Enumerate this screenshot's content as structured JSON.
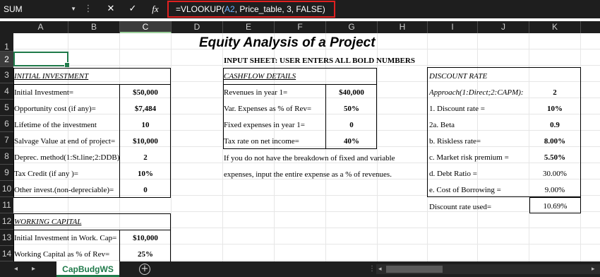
{
  "namebox": {
    "value": "SUM"
  },
  "formula_bar": {
    "cancel": "✕",
    "enter": "✓",
    "fx": "fx",
    "formula_prefix": "=VLOOKUP(",
    "formula_ref": "A2",
    "formula_suffix": ", Price_table, 3, FALSE)"
  },
  "columns": [
    "A",
    "B",
    "C",
    "D",
    "E",
    "F",
    "G",
    "H",
    "I",
    "J",
    "K"
  ],
  "rows": [
    "1",
    "2",
    "3",
    "4",
    "5",
    "6",
    "7",
    "8",
    "9",
    "10",
    "11",
    "12",
    "13",
    "14"
  ],
  "title": "Equity Analysis of a Project",
  "input_note": "INPUT SHEET: USER ENTERS ALL BOLD NUMBERS",
  "initial_investment": {
    "heading": "INITIAL INVESTMENT",
    "items": [
      {
        "label": "Initial Investment=",
        "value": "$50,000"
      },
      {
        "label": "Opportunity cost (if any)=",
        "value": "$7,484"
      },
      {
        "label": "Lifetime of the investment",
        "value": "10"
      },
      {
        "label": "Salvage Value at end of project=",
        "value": "$10,000"
      },
      {
        "label": "Deprec. method(1:St.line;2:DDB)",
        "value": "2"
      },
      {
        "label": "Tax Credit (if any )=",
        "value": "10%"
      },
      {
        "label": "Other invest.(non-depreciable)=",
        "value": "0"
      }
    ]
  },
  "cashflow": {
    "heading": "CASHFLOW DETAILS",
    "items": [
      {
        "label": "Revenues in  year 1=",
        "value": "$40,000"
      },
      {
        "label": "Var. Expenses as % of Rev=",
        "value": "50%"
      },
      {
        "label": "Fixed expenses in year 1=",
        "value": "0"
      },
      {
        "label": "Tax rate on net income=",
        "value": "40%"
      }
    ],
    "note_line1": "If you do not have the breakdown of fixed and variable",
    "note_line2": "expenses, input the entire expense as a % of revenues."
  },
  "discount": {
    "heading": "DISCOUNT RATE",
    "items": [
      {
        "label": "Approach(1:Direct;2:CAPM):",
        "value": "2"
      },
      {
        "label": "1. Discount rate =",
        "value": "10%"
      },
      {
        "label": "2a. Beta",
        "value": "0.9"
      },
      {
        "label": "b. Riskless rate=",
        "value": "8.00%"
      },
      {
        "label": "c. Market risk premium =",
        "value": "5.50%"
      },
      {
        "label": "d. Debt Ratio =",
        "value": "30.00%"
      },
      {
        "label": "e. Cost of Borrowing =",
        "value": "9.00%"
      }
    ],
    "used_label": "Discount rate used=",
    "used_value": "10.69%"
  },
  "working_capital": {
    "heading": "WORKING CAPITAL",
    "items": [
      {
        "label": "Initial Investment in Work. Cap=",
        "value": "$10,000"
      },
      {
        "label": "Working Capital as % of Rev=",
        "value": "25%"
      }
    ]
  },
  "sheet_tab": "CapBudgWS",
  "add_sheet": "+"
}
